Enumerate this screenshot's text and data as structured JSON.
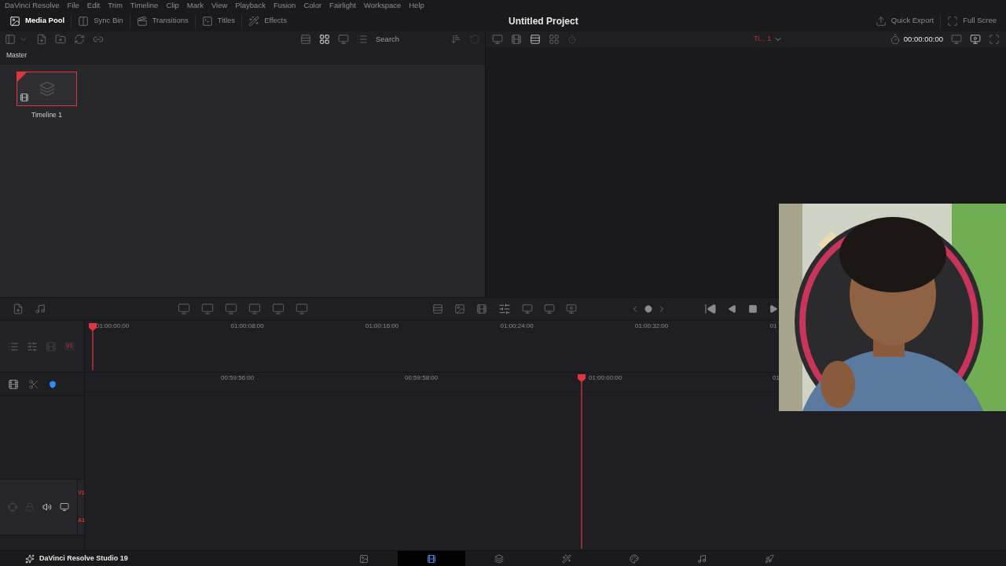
{
  "menu": [
    "DaVinci Resolve",
    "File",
    "Edit",
    "Trim",
    "Timeline",
    "Clip",
    "Mark",
    "View",
    "Playback",
    "Fusion",
    "Color",
    "Fairlight",
    "Workspace",
    "Help"
  ],
  "toolbar": {
    "tabs": [
      {
        "label": "Media Pool",
        "kind": "media",
        "selected": true
      },
      {
        "label": "Sync Bin",
        "kind": "sync",
        "selected": false
      },
      {
        "label": "Transitions",
        "kind": "transitions",
        "selected": false
      },
      {
        "label": "Titles",
        "kind": "titles",
        "selected": false
      },
      {
        "label": "Effects",
        "kind": "effects",
        "selected": false
      }
    ],
    "project_title": "Untitled Project",
    "actions": [
      {
        "label": "Quick Export",
        "kind": "export"
      },
      {
        "label": "Full Scree",
        "kind": "fullscreen"
      }
    ]
  },
  "media_pool": {
    "search": {
      "placeholder": "Search"
    },
    "bin": "Master",
    "clips": [
      {
        "name": "Timeline 1",
        "selected": true
      }
    ]
  },
  "viewer": {
    "timeline_name": "Ti... 1",
    "timecode": "00:00:00:00"
  },
  "mini_timeline": {
    "ticks": [
      "01:00:00:00",
      "01:00:08:00",
      "01:00:16:00",
      "01:00:24:00",
      "01:00:32:00",
      "01"
    ],
    "track": "V1"
  },
  "timeline": {
    "ticks": [
      "00:59:56:00",
      "00:59:58:00",
      "01:00:00:00",
      "01"
    ],
    "tracks": [
      "V1",
      "A1"
    ]
  },
  "status": {
    "app_name": "DaVinci Resolve Studio 19",
    "pages": [
      {
        "kind": "media",
        "selected": false
      },
      {
        "kind": "cut",
        "selected": true
      },
      {
        "kind": "edit",
        "selected": false
      },
      {
        "kind": "fusion",
        "selected": false
      },
      {
        "kind": "color",
        "selected": false
      },
      {
        "kind": "fairlight",
        "selected": false
      },
      {
        "kind": "deliver",
        "selected": false
      }
    ]
  }
}
